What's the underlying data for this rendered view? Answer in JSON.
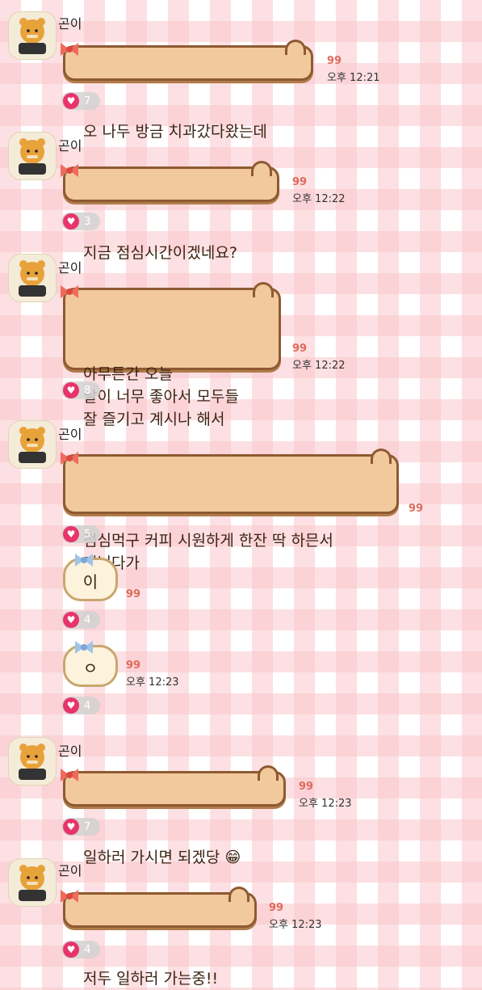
{
  "colors": {
    "bubble_fill": "#f2c99c",
    "bubble_border": "#8e5a31",
    "like_heart": "#e8346a",
    "read_count": "#e06a5c"
  },
  "messages": [
    {
      "sender": "곤이",
      "text": "오 나두 방금 치과갔다왔는데",
      "read": "99",
      "time": "오후 12:21",
      "likes": "7"
    },
    {
      "sender": "곤이",
      "text": "지금 점심시간이겠네요?",
      "read": "99",
      "time": "오후 12:22",
      "likes": "3"
    },
    {
      "sender": "곤이",
      "text": "아무튼간 오늘\n날이 너무 좋아서 모두들\n잘 즐기고 계시나 해서",
      "read": "99",
      "time": "오후 12:22",
      "likes": "8"
    },
    {
      "sender": "곤이",
      "text": "점심먹구 커피 시원하게 한잔 딱 하믄서\n거닐다가",
      "read": "99",
      "time": "",
      "likes": "5"
    },
    {
      "sender": "",
      "text": "이",
      "read": "99",
      "time": "",
      "likes": "4"
    },
    {
      "sender": "",
      "text": "ㅇ",
      "read": "99",
      "time": "오후 12:23",
      "likes": "4"
    },
    {
      "sender": "곤이",
      "text": "일하러 가시면 되겠당 😁",
      "read": "99",
      "time": "오후 12:23",
      "likes": "7"
    },
    {
      "sender": "곤이",
      "text": "저두 일하러 가는중!!",
      "read": "99",
      "time": "오후 12:23",
      "likes": "4"
    }
  ]
}
